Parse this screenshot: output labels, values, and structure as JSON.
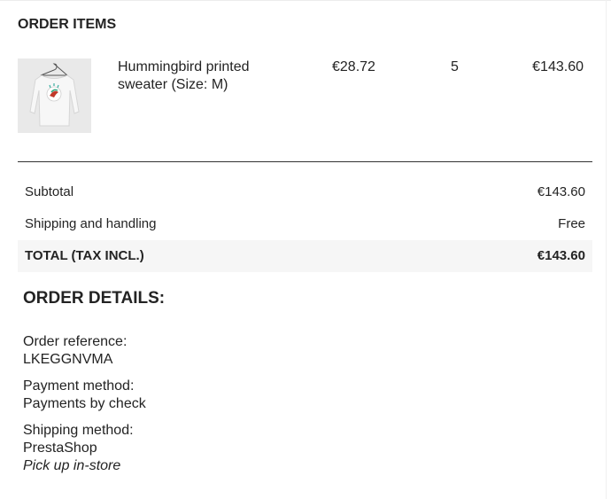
{
  "order_items": {
    "title": "ORDER ITEMS",
    "items": [
      {
        "image_icon": "sweater-product-image",
        "name": "Hummingbird printed sweater (Size: M)",
        "unit_price": "€28.72",
        "quantity": "5",
        "total": "€143.60"
      }
    ]
  },
  "totals": {
    "subtotal_label": "Subtotal",
    "subtotal_value": "€143.60",
    "shipping_label": "Shipping and handling",
    "shipping_value": "Free",
    "total_label": "TOTAL (TAX INCL.)",
    "total_value": "€143.60"
  },
  "order_details": {
    "title": "ORDER DETAILS:",
    "reference_label": "Order reference:",
    "reference_value": "LKEGGNVMA",
    "payment_label": "Payment method:",
    "payment_value": "Payments by check",
    "shipping_label": "Shipping method:",
    "shipping_carrier": "PrestaShop",
    "shipping_detail": "Pick up in-store"
  },
  "colors": {
    "text": "#232323",
    "total_row_bg": "#f6f6f6",
    "image_bg": "#e9e9e9",
    "divider": "#333333"
  }
}
